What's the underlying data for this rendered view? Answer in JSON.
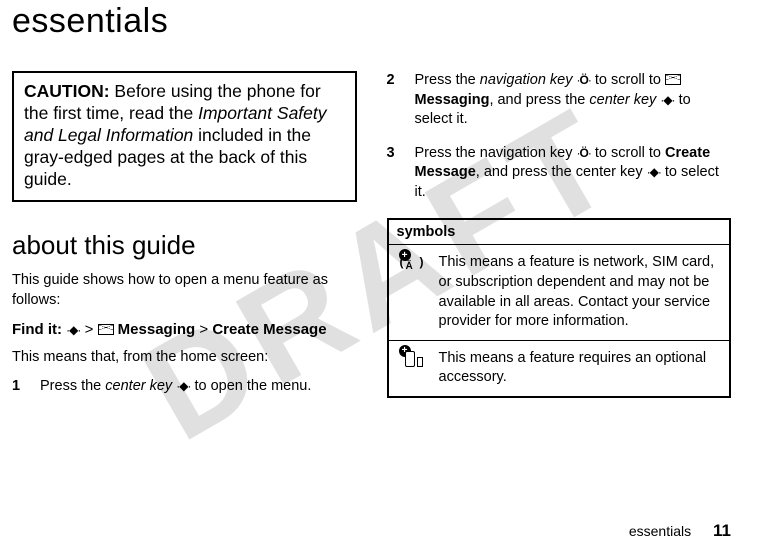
{
  "watermark": "DRAFT",
  "page_title": "essentials",
  "caution": {
    "label": "CAUTION:",
    "pre_text": " Before using the phone for the first time, read the ",
    "italic": "Important Safety and Legal Information",
    "post_text": " included in the gray-edged pages at the back of this guide."
  },
  "section_heading": "about this guide",
  "intro": "This guide shows how to open a menu feature as follows:",
  "findit": {
    "label": "Find it:",
    "path_messaging": "Messaging",
    "path_sep": ">",
    "path_create": "Create Message"
  },
  "means": "This means that, from the home screen:",
  "steps": {
    "s1": {
      "num": "1",
      "a": "Press the ",
      "b": "center key",
      "c": " to open the menu."
    },
    "s2": {
      "num": "2",
      "a": "Press the ",
      "b": "navigation key",
      "c": " to scroll to ",
      "d": "Messaging",
      "e": ", and press the ",
      "f": "center key",
      "g": " to select it."
    },
    "s3": {
      "num": "3",
      "a": "Press the navigation key ",
      "b": " to scroll to ",
      "c": "Create Message",
      "d": ", and press the center key ",
      "e": " to select it."
    }
  },
  "symbols": {
    "header": "symbols",
    "row1": "This means a feature is network, SIM card, or subscription dependent and may not be available in all areas. Contact your service provider for more information.",
    "row2": "This means a feature requires an optional accessory."
  },
  "footer": {
    "label": "essentials",
    "page": "11"
  }
}
